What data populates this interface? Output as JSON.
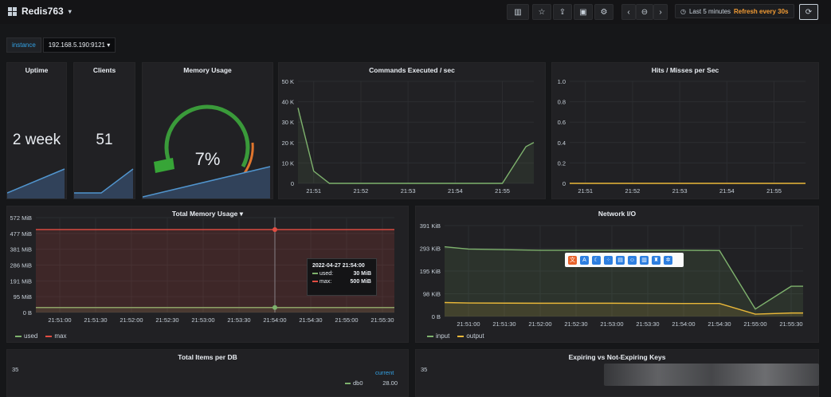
{
  "app": {
    "title": "Redis763"
  },
  "toolbar": {
    "time_range": "Last 5 minutes",
    "refresh": "Refresh every 30s"
  },
  "variable": {
    "label": "instance",
    "value": "192.168.5.190:9121"
  },
  "panels": {
    "uptime": {
      "title": "Uptime",
      "value": "2 week"
    },
    "clients": {
      "title": "Clients",
      "value": "51"
    },
    "memory_usage": {
      "title": "Memory Usage",
      "value": "7%",
      "percent": 7
    },
    "commands": {
      "title": "Commands Executed / sec"
    },
    "hits": {
      "title": "Hits / Misses per Sec"
    },
    "total_memory": {
      "title": "Total Memory Usage"
    },
    "network": {
      "title": "Network I/O"
    },
    "items_db": {
      "title": "Total Items per DB",
      "y_top": "35",
      "legend_header": "current",
      "legend_name": "db0",
      "legend_value": "28.00"
    },
    "expiring": {
      "title": "Expiring vs Not-Expiring Keys",
      "y_top": "35"
    }
  },
  "tooltip": {
    "time": "2022-04-27 21:54:00",
    "used_label": "used:",
    "used_value": "30 MiB",
    "max_label": "max:",
    "max_value": "500 MiB"
  },
  "colors": {
    "green": "#7eb26d",
    "red": "#e24d42",
    "yellow": "#eab839",
    "blue": "#5195ce"
  },
  "chart_data": [
    {
      "type": "line",
      "title": "Commands Executed / sec",
      "x": [
        "21:50:40",
        "21:51",
        "21:51:20",
        "21:51:40",
        "21:52",
        "21:53",
        "21:54",
        "21:55",
        "21:55:30",
        "21:55:40"
      ],
      "series": [
        {
          "values": [
            37000,
            6000,
            0,
            0,
            0,
            0,
            0,
            0,
            18000,
            20000
          ]
        }
      ],
      "xticks": [
        "21:51",
        "21:52",
        "21:53",
        "21:54",
        "21:55"
      ],
      "yticks": [
        "0",
        "10 K",
        "20 K",
        "30 K",
        "40 K",
        "50 K"
      ],
      "ylim": [
        0,
        50000
      ]
    },
    {
      "type": "line",
      "title": "Hits / Misses per Sec",
      "x": [
        "21:50:40",
        "21:55:40"
      ],
      "series": [
        {
          "values": [
            0,
            0
          ]
        }
      ],
      "xticks": [
        "21:51",
        "21:52",
        "21:53",
        "21:54",
        "21:55"
      ],
      "yticks": [
        "0",
        "0.2",
        "0.4",
        "0.6",
        "0.8",
        "1.0"
      ],
      "ylim": [
        0,
        1
      ]
    },
    {
      "type": "area",
      "title": "Total Memory Usage",
      "x": [
        "21:50:40",
        "21:55:40"
      ],
      "series": [
        {
          "name": "used",
          "values": [
            30,
            30
          ]
        },
        {
          "name": "max",
          "values": [
            500,
            500
          ]
        }
      ],
      "xticks": [
        "21:51:00",
        "21:51:30",
        "21:52:00",
        "21:52:30",
        "21:53:00",
        "21:53:30",
        "21:54:00",
        "21:54:30",
        "21:55:00",
        "21:55:30"
      ],
      "yticks": [
        "0 B",
        "95 MiB",
        "191 MiB",
        "286 MiB",
        "381 MiB",
        "477 MiB",
        "572 MiB"
      ],
      "ylim": [
        0,
        572
      ]
    },
    {
      "type": "area",
      "title": "Network I/O",
      "x": [
        "21:50:40",
        "21:51:00",
        "21:52:00",
        "21:53:00",
        "21:54:00",
        "21:54:30",
        "21:55:00",
        "21:55:30",
        "21:55:40"
      ],
      "series": [
        {
          "name": "input",
          "values": [
            300,
            290,
            285,
            285,
            285,
            284,
            32,
            130,
            130
          ]
        },
        {
          "name": "output",
          "values": [
            60,
            58,
            57,
            57,
            56,
            56,
            10,
            15,
            15
          ]
        }
      ],
      "xticks": [
        "21:51:00",
        "21:51:30",
        "21:52:00",
        "21:52:30",
        "21:53:00",
        "21:53:30",
        "21:54:00",
        "21:54:30",
        "21:55:00",
        "21:55:30"
      ],
      "yticks": [
        "0 B",
        "98 KiB",
        "195 KiB",
        "293 KiB",
        "391 KiB"
      ],
      "ylim": [
        0,
        391
      ]
    }
  ]
}
